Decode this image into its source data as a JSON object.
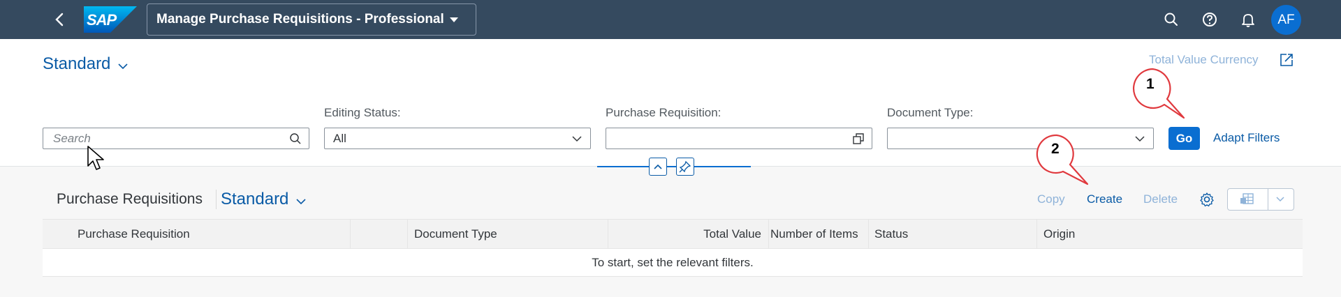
{
  "shell": {
    "title": "Manage Purchase Requisitions - Professional",
    "avatar_initials": "AF",
    "logo_text": "SAP",
    "back_icon": "chevron-left-icon",
    "search_icon": "search-icon",
    "help_icon": "help-icon",
    "notifications_icon": "bell-icon"
  },
  "filterbar": {
    "variant_name": "Standard",
    "total_value_currency": "Total Value Currency",
    "search": {
      "placeholder": "Search",
      "value": ""
    },
    "editing_status": {
      "label": "Editing Status:",
      "value": "All"
    },
    "purchase_requisition": {
      "label": "Purchase Requisition:",
      "value": ""
    },
    "document_type": {
      "label": "Document Type:",
      "value": ""
    },
    "go_label": "Go",
    "adapt_filters_label": "Adapt Filters"
  },
  "table": {
    "title": "Purchase Requisitions",
    "variant_name": "Standard",
    "actions": {
      "copy": "Copy",
      "create": "Create",
      "delete": "Delete"
    },
    "columns": [
      "Purchase Requisition",
      "",
      "Document Type",
      "Total Value",
      "Number of Items",
      "Status",
      "Origin"
    ],
    "no_data_text": "To start, set the relevant filters."
  },
  "callouts": [
    "1",
    "2"
  ],
  "colors": {
    "shell_bg": "#354a5f",
    "accent": "#0a6ed1",
    "link": "#0a5ba6",
    "disabled_link": "#8fb3d9"
  }
}
